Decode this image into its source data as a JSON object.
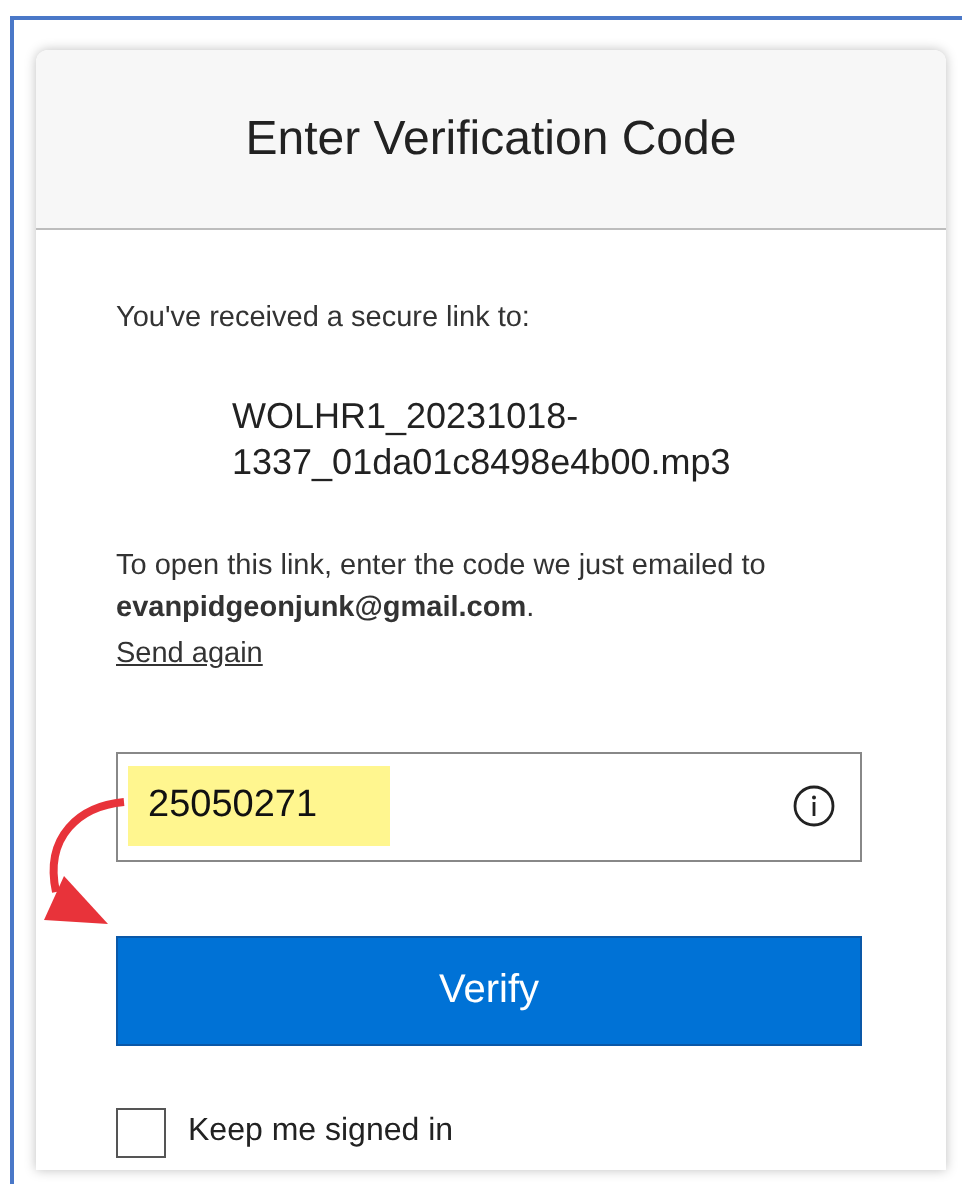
{
  "dialog": {
    "title": "Enter Verification Code"
  },
  "intro": "You've received a secure link to:",
  "file_name": [
    "WOLHR1_20231018-",
    "1337_01da01c8498e4b00.mp3"
  ],
  "instructions": "To open this link, enter the code we just emailed to **evanpidgeonjunk@gmail.com**.",
  "send_again_link": "Send again",
  "code_field": {
    "value": "25050271",
    "highlighted": true
  },
  "verify_button": "Verify",
  "keep_signed_in": {
    "label": "Keep me signed in",
    "checked": false
  }
}
